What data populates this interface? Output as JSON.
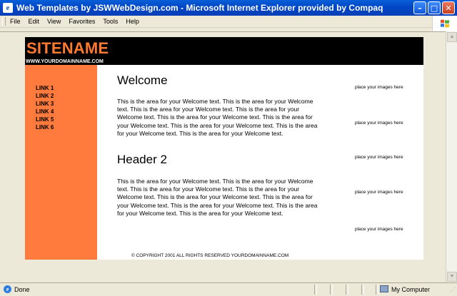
{
  "window": {
    "title": "Web Templates by JSWWebDesign.com - Microsoft Internet Explorer provided by Compaq",
    "app_icon": "ie-icon",
    "buttons": {
      "minimize": "–",
      "maximize": "□",
      "close": "✕"
    }
  },
  "menu": [
    "File",
    "Edit",
    "View",
    "Favorites",
    "Tools",
    "Help"
  ],
  "page": {
    "sitename": "SITENAME",
    "domain": "WWW.YOURDOMAINNAME.COM",
    "links": [
      "LINK 1",
      "LINK 2",
      "LINK 3",
      "LINK 4",
      "LINK 5",
      "LINK 6"
    ],
    "welcome_heading": "Welcome",
    "welcome_text": "This is the area for your Welcome text. This is the area for your Welcome text. This is the area for your Welcome text. This is the area for your Welcome text. This is the area for your Welcome text. This is the area for your Welcome text. This is the area for your Welcome text. This is the area for your Welcome text. This is the area for your Welcome text.",
    "header2_heading": "Header 2",
    "header2_text": "This is the area for your Welcome text. This is the area for your Welcome text. This is the area for your Welcome text. This is the area for your Welcome text. This is the area for your Welcome text. This is the area for your Welcome text. This is the area for your Welcome text. This is the area for your Welcome text. This is the area for your Welcome text.",
    "image_placeholders": [
      "place your images here",
      "place your images here",
      "place your images here",
      "place your images here",
      "place your images here"
    ],
    "copyright": "© COPYRIGHT 2001 ALL RIGHTS RESERVED YOURDOMAINNAME.COM"
  },
  "status": {
    "text": "Done",
    "zone": "My Computer"
  },
  "colors": {
    "accent": "#ff7a3d",
    "sitename": "#ff7a2e",
    "header_bg": "#000000",
    "titlebar": "#0046c7"
  }
}
